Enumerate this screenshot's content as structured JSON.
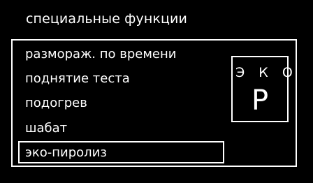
{
  "header": {
    "title": "специальные функции"
  },
  "menu": {
    "items": [
      {
        "label": "размораж. по времени"
      },
      {
        "label": "поднятие теста"
      },
      {
        "label": "подогрев"
      },
      {
        "label": "шабат"
      },
      {
        "label": "эко-пиролиз"
      }
    ],
    "selected_index": 4
  },
  "mode_panel": {
    "label": "Э К О",
    "symbol": "P"
  },
  "colors": {
    "background": "#000000",
    "foreground": "#ffffff"
  }
}
